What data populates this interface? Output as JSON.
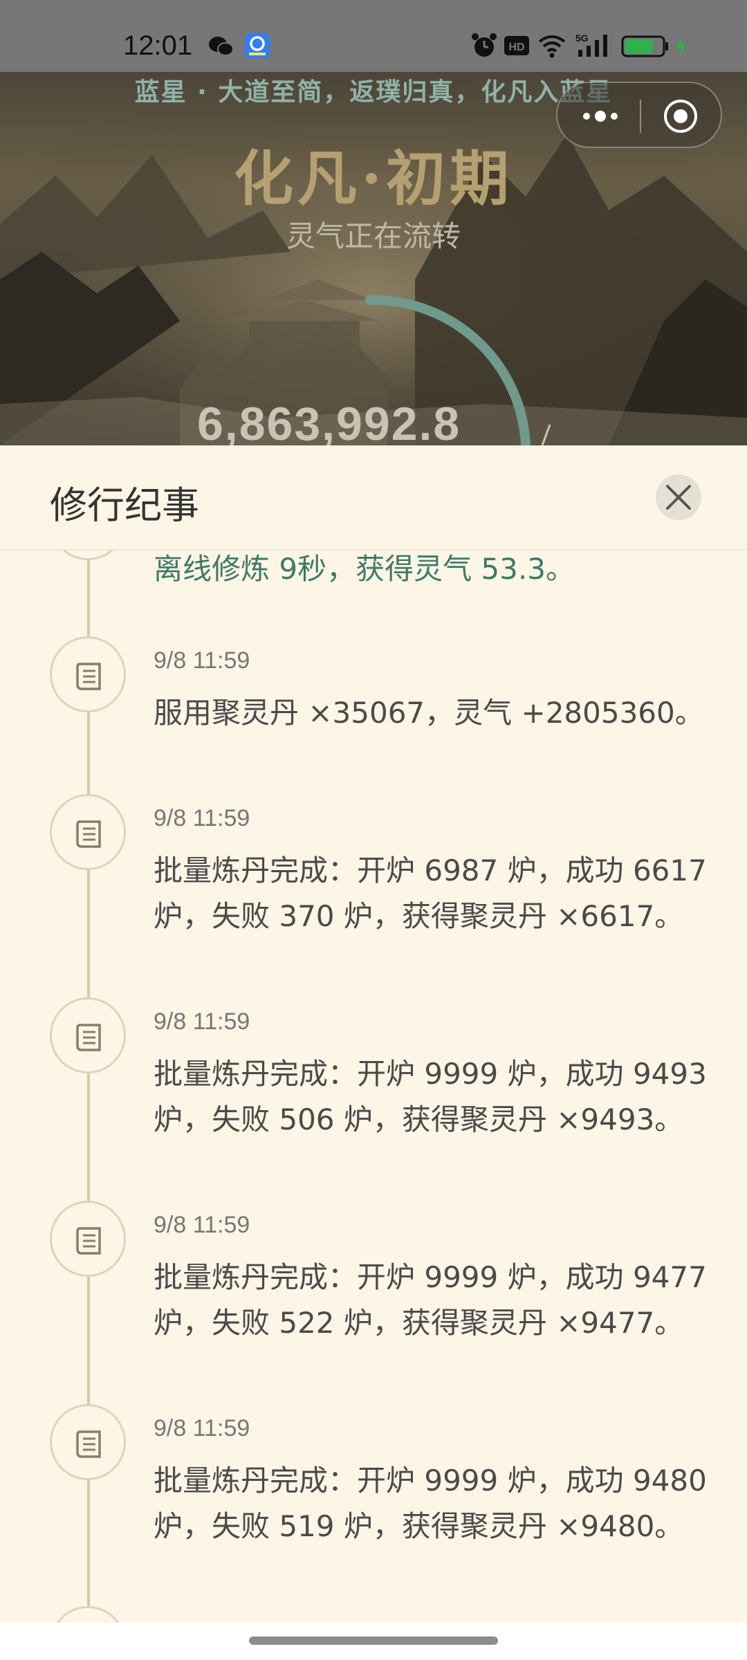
{
  "status_bar": {
    "time": "12:01",
    "icons": [
      "wechat-icon",
      "app-icon",
      "alarm-icon",
      "hd-icon",
      "wifi-icon",
      "5g-signal-icon",
      "battery-icon",
      "charging-icon"
    ],
    "battery_level": 0.7
  },
  "hero": {
    "subtitle": "蓝星 · 大道至简，返璞归真，化凡入蓝星",
    "title": "化凡·初期",
    "status": "灵气正在流转",
    "value": "6,863,992.8",
    "colors": {
      "title": "#b4a071",
      "subtitle": "#8fb3a9",
      "progress": "#6f9a8c"
    }
  },
  "mini_program_capsule": {
    "more": "more-icon",
    "close": "target-icon"
  },
  "sheet": {
    "title": "修行纪事",
    "close_icon": "close-icon",
    "entries": [
      {
        "time": "",
        "text": "离线修炼 9秒，获得灵气 53.3。",
        "accent": true
      },
      {
        "time": "9/8 11:59",
        "text": "服用聚灵丹 ×35067，灵气 +2805360。"
      },
      {
        "time": "9/8 11:59",
        "text": "批量炼丹完成：开炉 6987 炉，成功 6617 炉，失败 370 炉，获得聚灵丹 ×6617。"
      },
      {
        "time": "9/8 11:59",
        "text": "批量炼丹完成：开炉 9999 炉，成功 9493 炉，失败 506 炉，获得聚灵丹 ×9493。"
      },
      {
        "time": "9/8 11:59",
        "text": "批量炼丹完成：开炉 9999 炉，成功 9477 炉，失败 522 炉，获得聚灵丹 ×9477。"
      },
      {
        "time": "9/8 11:59",
        "text": "批量炼丹完成：开炉 9999 炉，成功 9480 炉，失败 519 炉，获得聚灵丹 ×9480。"
      }
    ],
    "colors": {
      "background": "#fdf5e6",
      "accent_text": "#3e7a67",
      "timeline": "#d8c9a6"
    }
  }
}
